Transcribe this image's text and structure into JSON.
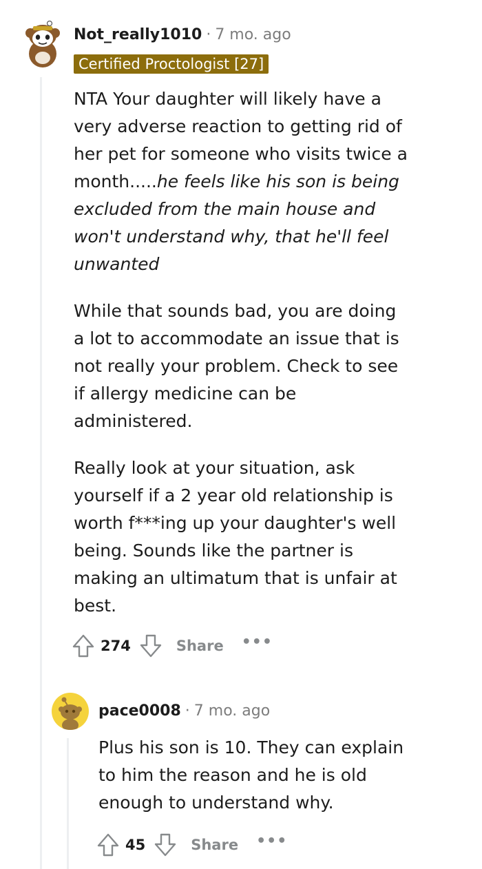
{
  "comments": [
    {
      "username": "Not_really1010",
      "separator": "·",
      "time": "7 mo. ago",
      "flair": "Certified Proctologist [27]",
      "body": {
        "p1_plain": "NTA Your daughter will likely have a very adverse reaction to getting rid of her pet for someone who visits twice a month.....",
        "p1_italic": "he feels like his son is being excluded from the main house and won't understand why, that he'll feel unwanted",
        "p2": "While that sounds bad, you are doing a lot to accommodate an issue that is not really your problem. Check to see if allergy medicine can be administered.",
        "p3": "Really look at your situation, ask yourself if a 2 year old relationship is worth f***ing up your daughter's well being. Sounds like the partner is making an ultimatum that is unfair at best."
      },
      "score": "274",
      "share_label": "Share",
      "more_label": "•••",
      "avatar_icon": "snoo-bear-avatar"
    },
    {
      "username": "pace0008",
      "separator": "·",
      "time": "7 mo. ago",
      "body": {
        "p1": "Plus his son is 10. They can explain to him the reason and he is old enough to understand why."
      },
      "score": "45",
      "share_label": "Share",
      "more_label": "•••",
      "avatar_icon": "snoo-avatar"
    }
  ],
  "colors": {
    "flair_bg": "#8c6d0c",
    "thread_line": "#edeff1",
    "muted_text": "#7c7c7c",
    "avatar2_bg": "#f5d33c"
  }
}
